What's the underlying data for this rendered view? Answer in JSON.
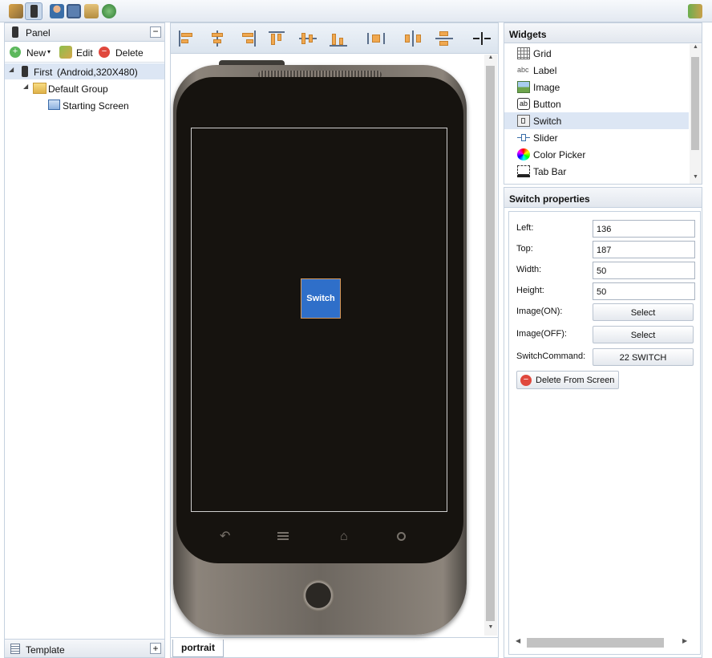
{
  "left_panel": {
    "title": "Panel",
    "toolbar": {
      "new_label": "New",
      "edit_label": "Edit",
      "delete_label": "Delete"
    },
    "tree": {
      "device_name": "First",
      "device_spec": "(Android,320X480)",
      "group_label": "Default Group",
      "screen_label": "Starting Screen"
    },
    "template_label": "Template"
  },
  "canvas": {
    "tab_label": "portrait",
    "switch_label": "Switch"
  },
  "widgets": {
    "title": "Widgets",
    "items": [
      {
        "label": "Grid",
        "icon": "grid-icon"
      },
      {
        "label": "Label",
        "icon": "label-icon",
        "icon_text": "abc"
      },
      {
        "label": "Image",
        "icon": "image-icon"
      },
      {
        "label": "Button",
        "icon": "button-icon",
        "icon_text": "ab"
      },
      {
        "label": "Switch",
        "icon": "switch-icon",
        "selected": true
      },
      {
        "label": "Slider",
        "icon": "slider-icon"
      },
      {
        "label": "Color Picker",
        "icon": "color-picker-icon"
      },
      {
        "label": "Tab Bar",
        "icon": "tab-bar-icon"
      }
    ]
  },
  "properties": {
    "title": "Switch properties",
    "left_label": "Left:",
    "left_value": "136",
    "top_label": "Top:",
    "top_value": "187",
    "width_label": "Width:",
    "width_value": "50",
    "height_label": "Height:",
    "height_value": "50",
    "image_on_label": "Image(ON):",
    "image_on_button": "Select",
    "image_off_label": "Image(OFF):",
    "image_off_button": "Select",
    "command_label": "SwitchCommand:",
    "command_value": "22 SWITCH",
    "delete_button": "Delete From Screen"
  },
  "colors": {
    "selection": "#dce6f4",
    "switch_fill": "#2f6fc9",
    "phone_screen": "#16130f"
  }
}
